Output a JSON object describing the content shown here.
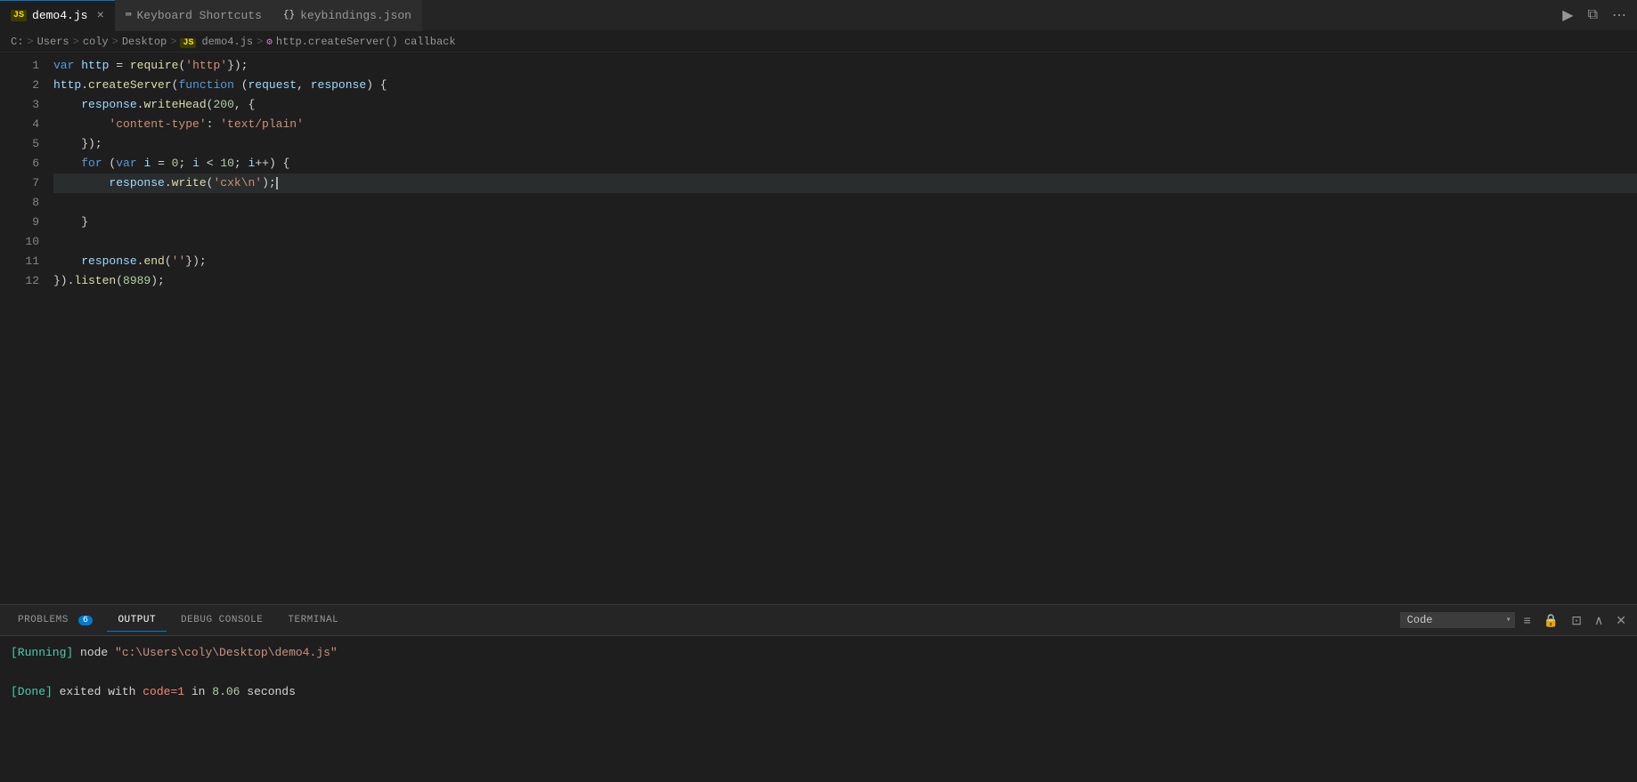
{
  "tabs": [
    {
      "id": "demo4js",
      "icon_type": "js",
      "label": "demo4.js",
      "active": true,
      "closeable": true
    },
    {
      "id": "keyboard-shortcuts",
      "icon_type": "kb",
      "label": "Keyboard Shortcuts",
      "active": false,
      "closeable": false
    },
    {
      "id": "keybindingsjson",
      "icon_type": "json",
      "label": "keybindings.json",
      "active": false,
      "closeable": false
    }
  ],
  "breadcrumb": {
    "parts": [
      "C:",
      "Users",
      "coly",
      "Desktop",
      "JS",
      "demo4.js"
    ],
    "separator": ">",
    "fn_label": "http.createServer() callback"
  },
  "editor": {
    "lines": [
      {
        "num": 1,
        "tokens": [
          {
            "t": "kw",
            "v": "var"
          },
          {
            "t": "plain",
            "v": " "
          },
          {
            "t": "var-name",
            "v": "http"
          },
          {
            "t": "plain",
            "v": " = "
          },
          {
            "t": "fn",
            "v": "require"
          },
          {
            "t": "punct",
            "v": "("
          },
          {
            "t": "str",
            "v": "'http'"
          },
          {
            "t": "punct",
            "v": "});"
          }
        ]
      },
      {
        "num": 2,
        "tokens": [
          {
            "t": "var-name",
            "v": "http"
          },
          {
            "t": "plain",
            "v": "."
          },
          {
            "t": "fn",
            "v": "createServer"
          },
          {
            "t": "punct",
            "v": "("
          },
          {
            "t": "kw",
            "v": "function"
          },
          {
            "t": "plain",
            "v": " ("
          },
          {
            "t": "param",
            "v": "request"
          },
          {
            "t": "plain",
            "v": ", "
          },
          {
            "t": "param",
            "v": "response"
          },
          {
            "t": "plain",
            "v": ") {"
          }
        ]
      },
      {
        "num": 3,
        "tokens": [
          {
            "t": "plain",
            "v": "    "
          },
          {
            "t": "var-name",
            "v": "response"
          },
          {
            "t": "plain",
            "v": "."
          },
          {
            "t": "fn",
            "v": "writeHead"
          },
          {
            "t": "punct",
            "v": "("
          },
          {
            "t": "num",
            "v": "200"
          },
          {
            "t": "plain",
            "v": ", {"
          }
        ]
      },
      {
        "num": 4,
        "tokens": [
          {
            "t": "plain",
            "v": "        "
          },
          {
            "t": "str",
            "v": "'content-type'"
          },
          {
            "t": "plain",
            "v": ": "
          },
          {
            "t": "str",
            "v": "'text/plain'"
          }
        ]
      },
      {
        "num": 5,
        "tokens": [
          {
            "t": "plain",
            "v": "    "
          },
          {
            "t": "punct",
            "v": "});"
          }
        ]
      },
      {
        "num": 6,
        "tokens": [
          {
            "t": "plain",
            "v": "    "
          },
          {
            "t": "kw",
            "v": "for"
          },
          {
            "t": "plain",
            "v": " ("
          },
          {
            "t": "kw",
            "v": "var"
          },
          {
            "t": "plain",
            "v": " "
          },
          {
            "t": "var-name",
            "v": "i"
          },
          {
            "t": "plain",
            "v": " = "
          },
          {
            "t": "num",
            "v": "0"
          },
          {
            "t": "plain",
            "v": "; "
          },
          {
            "t": "var-name",
            "v": "i"
          },
          {
            "t": "plain",
            "v": " < "
          },
          {
            "t": "num",
            "v": "10"
          },
          {
            "t": "plain",
            "v": "; "
          },
          {
            "t": "var-name",
            "v": "i"
          },
          {
            "t": "plain",
            "v": "++) {"
          }
        ]
      },
      {
        "num": 7,
        "tokens": [
          {
            "t": "plain",
            "v": "        "
          },
          {
            "t": "var-name",
            "v": "response"
          },
          {
            "t": "plain",
            "v": "."
          },
          {
            "t": "fn",
            "v": "write"
          },
          {
            "t": "punct",
            "v": "("
          },
          {
            "t": "str",
            "v": "'cxk\\n'"
          },
          {
            "t": "punct",
            "v": ");"
          },
          {
            "t": "cursor",
            "v": ""
          }
        ]
      },
      {
        "num": 8,
        "tokens": [
          {
            "t": "plain",
            "v": "    "
          }
        ]
      },
      {
        "num": 9,
        "tokens": [
          {
            "t": "plain",
            "v": "    "
          },
          {
            "t": "punct",
            "v": "}"
          }
        ]
      },
      {
        "num": 10,
        "tokens": []
      },
      {
        "num": 11,
        "tokens": [
          {
            "t": "plain",
            "v": "    "
          },
          {
            "t": "var-name",
            "v": "response"
          },
          {
            "t": "plain",
            "v": "."
          },
          {
            "t": "fn",
            "v": "end"
          },
          {
            "t": "punct",
            "v": "("
          },
          {
            "t": "str",
            "v": "''"
          },
          {
            "t": "punct",
            "v": "});"
          }
        ]
      },
      {
        "num": 12,
        "tokens": [
          {
            "t": "punct",
            "v": "})."
          },
          {
            "t": "fn",
            "v": "listen"
          },
          {
            "t": "punct",
            "v": "("
          },
          {
            "t": "num",
            "v": "8989"
          },
          {
            "t": "punct",
            "v": ");"
          }
        ]
      }
    ]
  },
  "panel": {
    "tabs": [
      {
        "id": "problems",
        "label": "PROBLEMS",
        "badge": "6",
        "active": false
      },
      {
        "id": "output",
        "label": "OUTPUT",
        "active": true
      },
      {
        "id": "debug-console",
        "label": "DEBUG CONSOLE",
        "active": false
      },
      {
        "id": "terminal",
        "label": "TERMINAL",
        "active": false
      }
    ],
    "output_select": "Code",
    "output_lines": [
      {
        "id": "running",
        "parts": [
          {
            "t": "output-running",
            "v": "[Running]"
          },
          {
            "t": "output-normal",
            "v": " node "
          },
          {
            "t": "output-path",
            "v": "\"c:\\Users\\coly\\Desktop\\demo4.js\""
          }
        ]
      },
      {
        "id": "blank",
        "parts": []
      },
      {
        "id": "done",
        "parts": [
          {
            "t": "output-done",
            "v": "[Done]"
          },
          {
            "t": "output-normal",
            "v": " exited with "
          },
          {
            "t": "output-red",
            "v": "code=1"
          },
          {
            "t": "output-normal",
            "v": " in "
          },
          {
            "t": "output-num",
            "v": "8.06"
          },
          {
            "t": "output-normal",
            "v": " seconds"
          }
        ]
      }
    ]
  },
  "toolbar_right": {
    "run_icon": "▶",
    "split_icon": "⧉",
    "more_icon": "⋯"
  }
}
